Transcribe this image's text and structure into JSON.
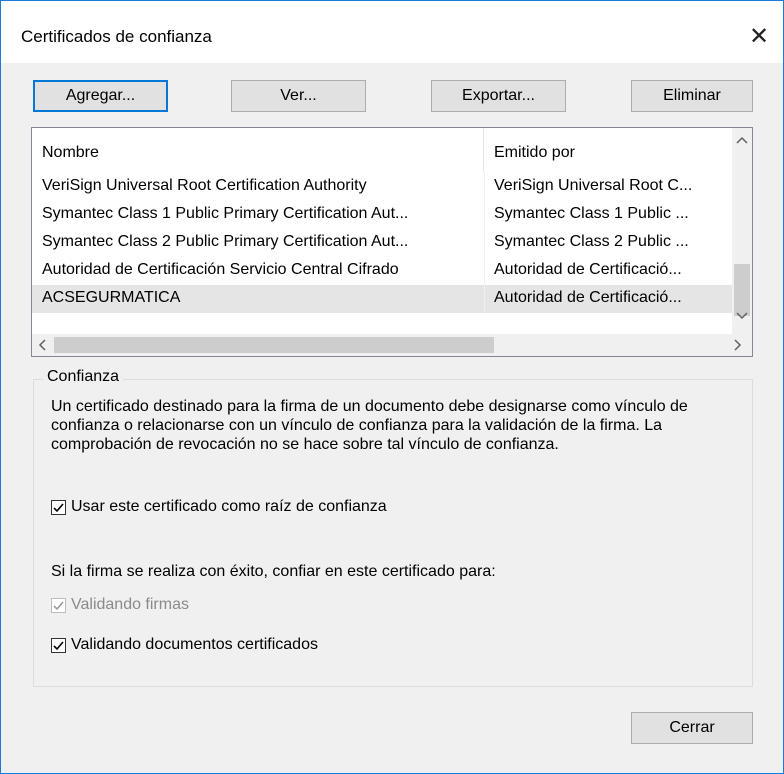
{
  "window": {
    "title": "Certificados de confianza",
    "close_glyph": "✕"
  },
  "toolbar": {
    "add_label": "Agregar...",
    "view_label": "Ver...",
    "export_label": "Exportar...",
    "delete_label": "Eliminar"
  },
  "table": {
    "columns": [
      "Nombre",
      "Emitido por"
    ],
    "rows": [
      [
        "VeriSign Universal Root Certification Authority",
        "VeriSign Universal Root C..."
      ],
      [
        "Symantec Class 1 Public Primary Certification Aut...",
        "Symantec Class 1 Public ..."
      ],
      [
        "Symantec Class 2 Public Primary Certification Aut...",
        "Symantec Class 2 Public ..."
      ],
      [
        "Autoridad de Certificación Servicio Central Cifrado",
        "Autoridad de Certificació..."
      ],
      [
        "ACSEGURMATICA",
        "Autoridad de Certificació..."
      ]
    ],
    "selected_row": 4
  },
  "trust": {
    "legend": "Confianza",
    "description": "Un certificado destinado para la firma de un documento debe designarse como vínculo de confianza o relacionarse con un vínculo de confianza para la validación de la firma. La comprobación de revocación no se hace sobre tal vínculo de confianza.",
    "use_as_root_label": "Usar este certificado como raíz de confianza",
    "use_as_root_checked": true,
    "trust_for_label": "Si la firma se realiza con éxito, confiar en este certificado para:",
    "validate_signatures_label": "Validando firmas",
    "validate_signatures_checked": true,
    "validate_signatures_disabled": true,
    "validate_certified_label": "Validando documentos certificados",
    "validate_certified_checked": true
  },
  "footer": {
    "close_label": "Cerrar"
  },
  "colors": {
    "accent": "#0078d7",
    "border": "#1a7ad8",
    "selected_row": "#e5e5e5"
  }
}
